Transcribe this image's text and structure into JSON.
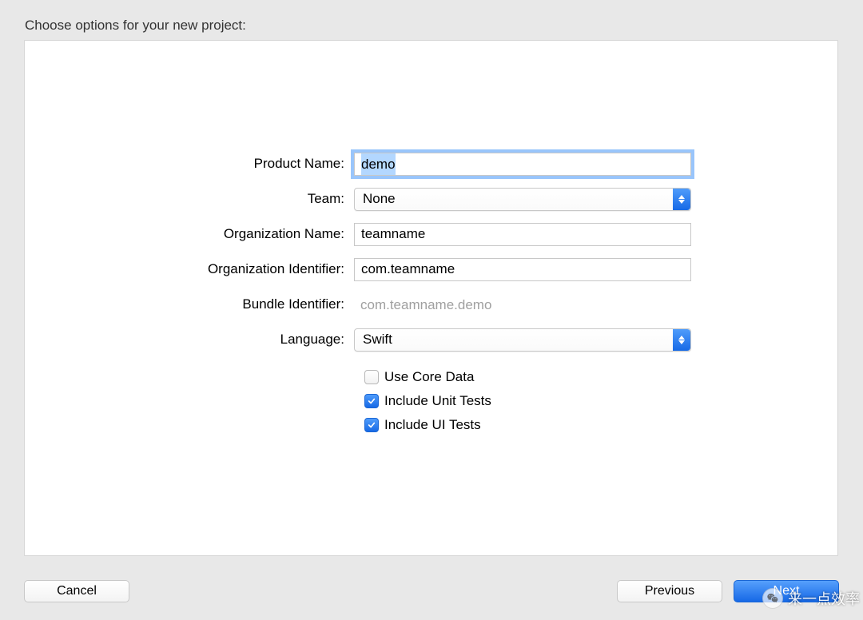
{
  "header": {
    "title": "Choose options for your new project:"
  },
  "form": {
    "productName": {
      "label": "Product Name:",
      "value": "demo"
    },
    "team": {
      "label": "Team:",
      "value": "None"
    },
    "orgName": {
      "label": "Organization Name:",
      "value": "teamname"
    },
    "orgIdentifier": {
      "label": "Organization Identifier:",
      "value": "com.teamname"
    },
    "bundleIdentifier": {
      "label": "Bundle Identifier:",
      "value": "com.teamname.demo"
    },
    "language": {
      "label": "Language:",
      "value": "Swift"
    },
    "useCoreData": {
      "label": "Use Core Data",
      "checked": false
    },
    "includeUnitTests": {
      "label": "Include Unit Tests",
      "checked": true
    },
    "includeUITests": {
      "label": "Include UI Tests",
      "checked": true
    }
  },
  "footer": {
    "cancel": "Cancel",
    "previous": "Previous",
    "next": "Next"
  },
  "watermark": {
    "text": "来一点效率"
  }
}
